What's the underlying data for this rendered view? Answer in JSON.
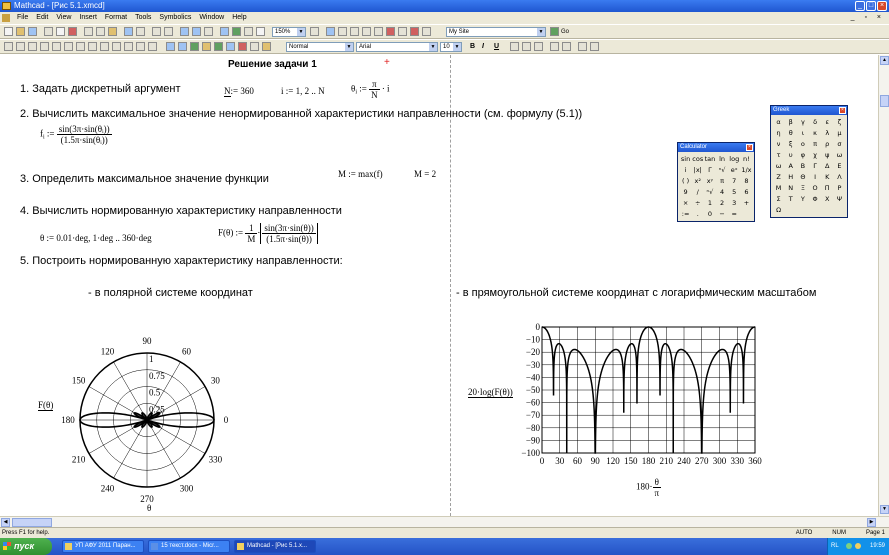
{
  "window": {
    "title": "Mathcad - [Рис 5.1.xmcd]",
    "btn_min": "_",
    "btn_max": "□",
    "btn_close": "×"
  },
  "menu": {
    "items": [
      "File",
      "Edit",
      "View",
      "Insert",
      "Format",
      "Tools",
      "Symbolics",
      "Window",
      "Help"
    ],
    "doc_controls": "_ ▫ ×"
  },
  "toolbar": {
    "zoom": "150%",
    "site": "My Site",
    "go": "Go",
    "style": "Normal",
    "font": "Arial",
    "size": "10",
    "bold": "B",
    "italic": "I",
    "underline": "U"
  },
  "doc": {
    "heading": "Решение задачи 1",
    "step1": "1. Задать дискретный аргумент",
    "step2": "2. Вычислить максимальное значение ненормированной характеристики направленности  (см. формулу (5.1))",
    "step3": "3. Определить максимальное значение функции",
    "step4": "4. Вычислить нормированную характеристику направленности",
    "step5": "5. Построить нормированную характеристику направленности:",
    "polar_caption": "- в полярной системе координат",
    "rect_caption": "- в прямоугольной системе координат с логарифмическим масштабом",
    "eq_N_lhs": "N",
    "eq_N_rhs": ":= 360",
    "eq_i": "i := 1, 2 .. N",
    "eq_theta_lhs": "θ",
    "eq_theta_sub": "i",
    "eq_theta_assign": ":=",
    "eq_theta_num": "π",
    "eq_theta_den": "N",
    "eq_theta_tail": "· i",
    "eq_f_lhs": "f",
    "eq_f_sub": "i",
    "eq_f_assign": ":=",
    "eq_f_num": "sin(3π·sin(θᵢ))",
    "eq_f_den": "(1.5π·sin(θᵢ))",
    "eq_M": "M := max(f)",
    "eq_M_val": "M = 2",
    "eq_range": "θ := 0.01·deg, 1·deg .. 360·deg",
    "eq_F_lhs": "F(θ) :=",
    "eq_F_coef_num": "1",
    "eq_F_coef_den": "M",
    "eq_F_num": "sin(3π·sin(θ))",
    "eq_F_den": "(1.5π·sin(θ))",
    "polar_ylabel": "F(θ)",
    "polar_xlabel": "θ",
    "rect_ylabel": "20·log(F(θ))",
    "rect_xlabel_coef": "180·",
    "rect_xlabel_num": "θ",
    "rect_xlabel_den": "π",
    "cursor_mark": "+"
  },
  "calculator": {
    "title": "Calculator",
    "rows": [
      [
        "sin",
        "cos",
        "tan",
        "ln",
        "log",
        "n!"
      ],
      [
        "i",
        "|x|",
        "Γ",
        "ⁿ√",
        "eˣ",
        "1/x"
      ],
      [
        "( )",
        "x²",
        "xʸ",
        "π",
        "7",
        "8"
      ],
      [
        "9",
        "/",
        "ⁿ√",
        "4",
        "5",
        "6"
      ],
      [
        "×",
        "÷",
        "1",
        "2",
        "3",
        "+"
      ],
      [
        ":=",
        ".",
        "0",
        "−",
        "="
      ]
    ]
  },
  "greek": {
    "title": "Greek",
    "rows": [
      [
        "α",
        "β",
        "γ",
        "δ",
        "ε",
        "ζ"
      ],
      [
        "η",
        "θ",
        "ι",
        "κ",
        "λ",
        "μ"
      ],
      [
        "ν",
        "ξ",
        "ο",
        "π",
        "ρ",
        "σ"
      ],
      [
        "τ",
        "υ",
        "φ",
        "χ",
        "ψ",
        "ω"
      ],
      [
        "ω",
        "Α",
        "Β",
        "Γ",
        "Δ",
        "Ε"
      ],
      [
        "Ζ",
        "Η",
        "Θ",
        "Ι",
        "Κ",
        "Λ"
      ],
      [
        "Μ",
        "Ν",
        "Ξ",
        "Ο",
        "Π",
        "Ρ"
      ],
      [
        "Σ",
        "Τ",
        "Υ",
        "Φ",
        "Χ",
        "Ψ"
      ],
      [
        "Ω"
      ]
    ]
  },
  "polar_chart": {
    "angle_ticks": [
      "90",
      "60",
      "30",
      "0",
      "330",
      "300",
      "270",
      "240",
      "210",
      "180",
      "150",
      "120"
    ],
    "radial_ticks": [
      "1",
      "0.75",
      "0.5",
      "0.25"
    ],
    "radial_max": 1
  },
  "chart_data": {
    "type": "line",
    "title": "",
    "xlabel": "180·θ/π",
    "ylabel": "20·log(F(θ))",
    "xlim": [
      0,
      360
    ],
    "ylim": [
      -100,
      0
    ],
    "xticks": [
      "0",
      "30",
      "60",
      "90",
      "120",
      "150",
      "180",
      "210",
      "240",
      "270",
      "300",
      "330",
      "360"
    ],
    "yticks": [
      "0",
      "−10",
      "−20",
      "−30",
      "−40",
      "−50",
      "−60",
      "−70",
      "−80",
      "−90",
      "−100"
    ],
    "grid": true,
    "function": "20·log10(|sin(3π·sin θ)| / (1.5π·|sin θ|) / 2)"
  },
  "status": {
    "left": "Press F1 for help.",
    "auto": "AUTO",
    "num": "NUM",
    "page": "Page 1"
  },
  "taskbar": {
    "start": "пуск",
    "tasks": [
      "УП АФУ 2011 Паран...",
      "15 текст.docx - Micr...",
      "Mathcad - [Рис 5.1.x..."
    ],
    "lang": "RL",
    "clock": "19:59"
  }
}
